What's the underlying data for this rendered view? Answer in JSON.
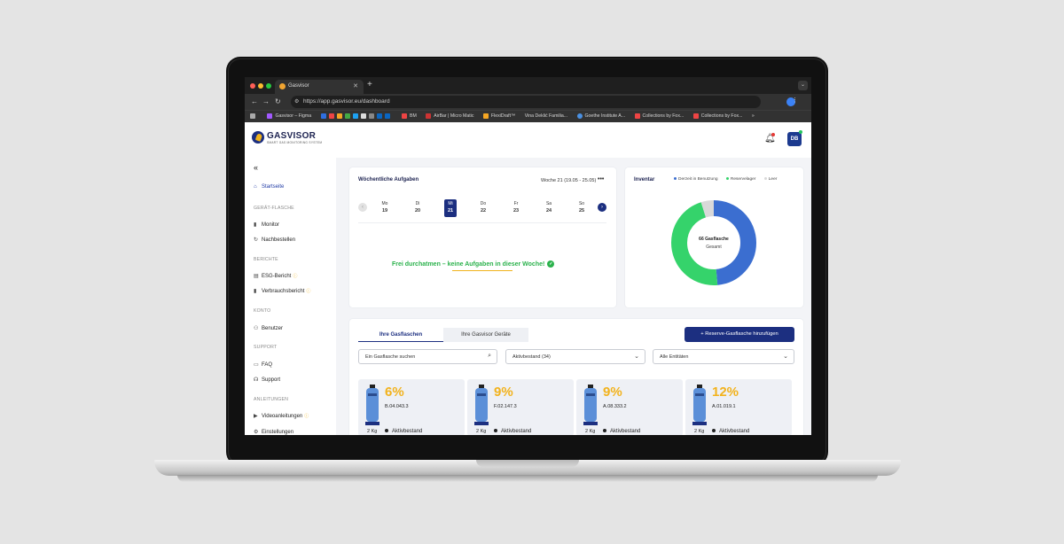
{
  "browser": {
    "tab_title": "Gasvisor",
    "url": "https://app.gasvisor.eu/dashboard",
    "bookmarks": [
      "Gasvisor – Figma",
      "BM",
      "AirBar | Micro Matic",
      "FlexiDraft™",
      "Vina Deklić Familia...",
      "Goethe Institute A...",
      "Collections by Fox...",
      "Collections by Fox..."
    ]
  },
  "header": {
    "logo_word": "GASVISOR",
    "logo_tagline": "SMART GAS MONITORING SYSTEM",
    "avatar_initials": "DB"
  },
  "sidebar": {
    "startseite": "Startseite",
    "sec_geraet": "GERÄT-FLASCHE",
    "monitor": "Monitor",
    "nachbestellen": "Nachbestellen",
    "sec_berichte": "BERICHTE",
    "esg": "ESG-Bericht",
    "verbrauch": "Verbrauchsbericht",
    "sec_konto": "KONTO",
    "benutzer": "Benutzer",
    "sec_support": "SUPPORT",
    "faq": "FAQ",
    "support": "Support",
    "sec_anleitungen": "ANLEITUNGEN",
    "video": "Videoanleitungen",
    "einstellungen": "Einstellungen"
  },
  "tasks": {
    "title": "Wöchentliche Aufgaben",
    "week": "Woche 21 (19.05 - 25.05)",
    "days": [
      {
        "name": "Mo",
        "date": "19"
      },
      {
        "name": "Di",
        "date": "20"
      },
      {
        "name": "Mi",
        "date": "21"
      },
      {
        "name": "Do",
        "date": "22"
      },
      {
        "name": "Fr",
        "date": "23"
      },
      {
        "name": "Sa",
        "date": "24"
      },
      {
        "name": "So",
        "date": "25"
      }
    ],
    "active_day": 2,
    "empty_message": "Frei durchatmen – keine Aufgaben in dieser Woche!"
  },
  "inventory": {
    "title": "Inventar",
    "legend": [
      "Derzeit in Benutzung",
      "Reservelager",
      "Leer"
    ],
    "center_count": "66 Gasflasche",
    "center_label": "Gesamt",
    "segments": [
      0.485,
      0.465,
      0.05
    ],
    "colors": [
      "#3b6ed0",
      "#35d36b",
      "#d9d9d9"
    ]
  },
  "panel": {
    "tab_active": "Ihre Gasflaschen",
    "tab_inactive": "Ihre Gasvisor Geräte",
    "add_button": "Reserve-Gasflasche hinzufügen",
    "search_placeholder": "Ein Gasflasche suchen",
    "filter_status": "Aktivbestand (34)",
    "filter_entity": "Alle Entitäten",
    "cylinders": [
      {
        "pct": "6%",
        "code": "B.04.043.3",
        "kg": "2 Kg",
        "status": "Aktivbestand"
      },
      {
        "pct": "9%",
        "code": "F.02.147.3",
        "kg": "2 Kg",
        "status": "Aktivbestand"
      },
      {
        "pct": "9%",
        "code": "A.08.333.2",
        "kg": "2 Kg",
        "status": "Aktivbestand"
      },
      {
        "pct": "12%",
        "code": "A.01.019.1",
        "kg": "2 Kg",
        "status": "Aktivbestand"
      }
    ]
  }
}
